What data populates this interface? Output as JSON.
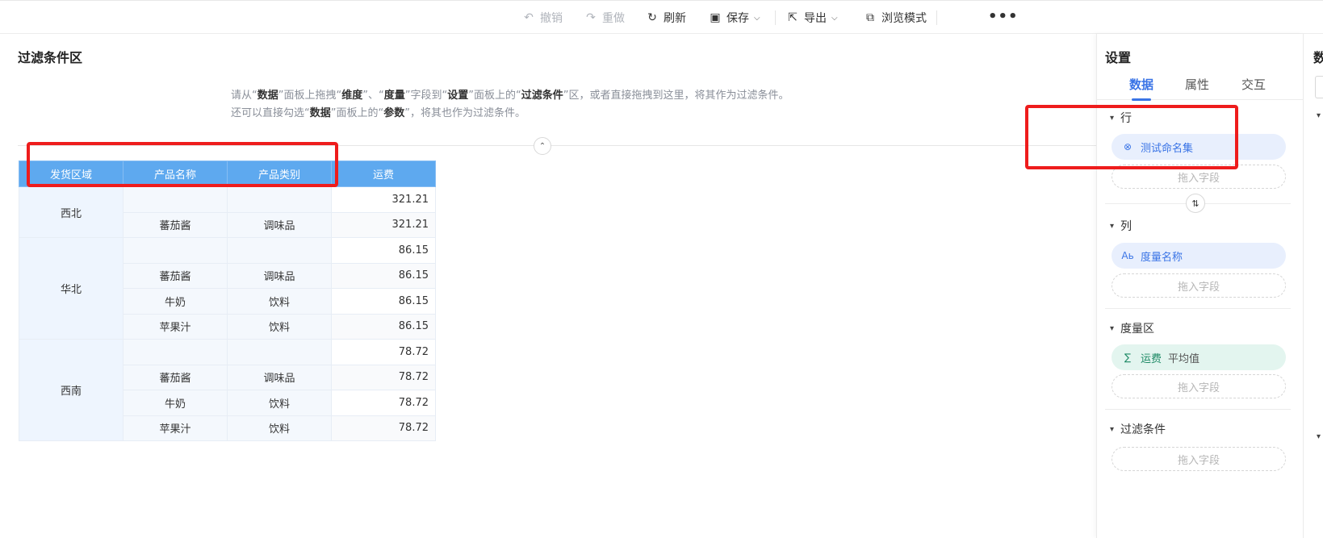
{
  "toolbar": {
    "undo": "撤销",
    "redo": "重做",
    "refresh": "刷新",
    "save": "保存",
    "export": "导出",
    "preview": "浏览模式",
    "more": "•••"
  },
  "filter_area": {
    "title": "过滤条件区",
    "hint_line1": [
      {
        "text": "请从“",
        "bold": false
      },
      {
        "text": "数据",
        "bold": true
      },
      {
        "text": "”面板上拖拽“",
        "bold": false
      },
      {
        "text": "维度",
        "bold": true
      },
      {
        "text": "”、“",
        "bold": false
      },
      {
        "text": "度量",
        "bold": true
      },
      {
        "text": "”字段到“",
        "bold": false
      },
      {
        "text": "设置",
        "bold": true
      },
      {
        "text": "”面板上的“",
        "bold": false
      },
      {
        "text": "过滤条件",
        "bold": true
      },
      {
        "text": "”区，或者直接拖拽到这里，将其作为过滤条件。",
        "bold": false
      }
    ],
    "hint_line2": [
      {
        "text": "还可以直接勾选“",
        "bold": false
      },
      {
        "text": "数据",
        "bold": true
      },
      {
        "text": "”面板上的“",
        "bold": false
      },
      {
        "text": "参数",
        "bold": true
      },
      {
        "text": "”，将其也作为过滤条件。",
        "bold": false
      }
    ],
    "collapse_glyph": "⌃"
  },
  "table": {
    "headers": [
      "发货区域",
      "产品名称",
      "产品类别",
      "运费"
    ],
    "groups": [
      {
        "region": "西北",
        "rows": [
          {
            "product": "",
            "category": "",
            "freight": "321.21"
          },
          {
            "product": "蕃茄酱",
            "category": "调味品",
            "freight": "321.21"
          }
        ]
      },
      {
        "region": "华北",
        "rows": [
          {
            "product": "",
            "category": "",
            "freight": "86.15"
          },
          {
            "product": "蕃茄酱",
            "category": "调味品",
            "freight": "86.15"
          },
          {
            "product": "牛奶",
            "category": "饮料",
            "freight": "86.15"
          },
          {
            "product": "苹果汁",
            "category": "饮料",
            "freight": "86.15"
          }
        ]
      },
      {
        "region": "西南",
        "rows": [
          {
            "product": "",
            "category": "",
            "freight": "78.72"
          },
          {
            "product": "蕃茄酱",
            "category": "调味品",
            "freight": "78.72"
          },
          {
            "product": "牛奶",
            "category": "饮料",
            "freight": "78.72"
          },
          {
            "product": "苹果汁",
            "category": "饮料",
            "freight": "78.72"
          }
        ]
      }
    ]
  },
  "settings": {
    "title": "设置",
    "tabs": [
      "数据",
      "属性",
      "交互"
    ],
    "active_tab": 0,
    "rows_section": {
      "label": "行",
      "field": "测试命名集",
      "drop": "拖入字段"
    },
    "cols_section": {
      "label": "列",
      "field": "度量名称",
      "field_icon": "Aь",
      "drop": "拖入字段"
    },
    "measure_section": {
      "label": "度量区",
      "field": "运费",
      "aggregation": "平均值",
      "drop": "拖入字段"
    },
    "filter_section": {
      "label": "过滤条件",
      "drop": "拖入字段"
    }
  },
  "data_panel": {
    "title": "数"
  },
  "colors": {
    "accent": "#3a74e6",
    "header_blue": "#5ea9ef",
    "highlight_red": "#ee1c1c"
  }
}
